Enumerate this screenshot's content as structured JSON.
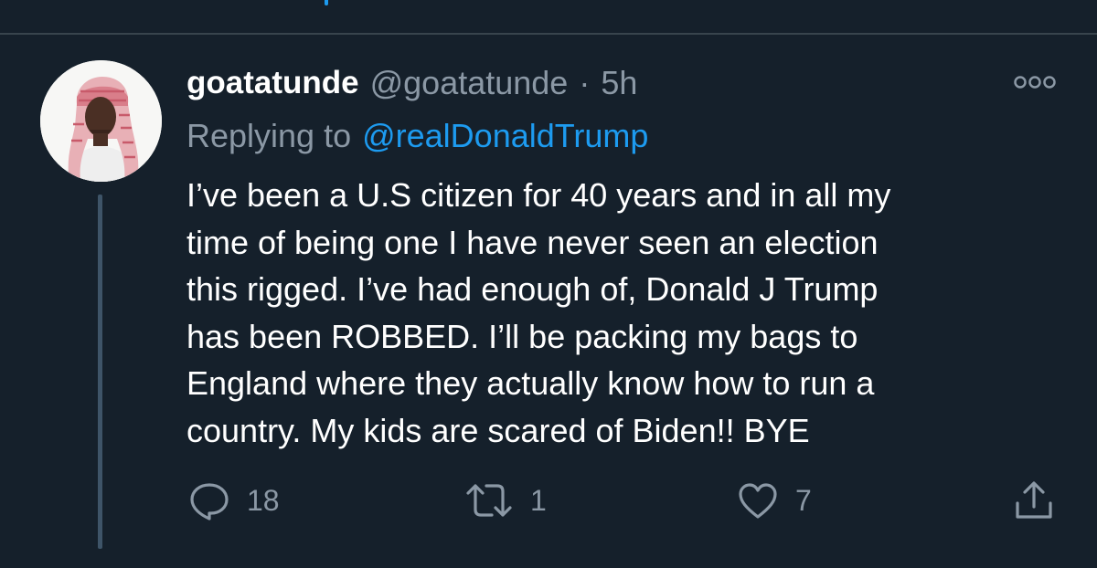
{
  "tweet": {
    "display_name": "goatatunde",
    "handle": "@goatatunde",
    "separator": "·",
    "time_ago": "5h",
    "replying_label": "Replying to",
    "replying_to": "@realDonaldTrump",
    "text_lines": [
      "I’ve been a U.S citizen for 40 years and in all my",
      "time of being one I have never seen an election",
      "this rigged. I’ve had enough of, Donald J Trump",
      "has been ROBBED. I’ll be packing my bags to",
      "England where they actually know how to run a",
      "country. My kids are scared of Biden!! BYE"
    ]
  },
  "actions": {
    "reply": {
      "icon": "reply-icon",
      "count": "18"
    },
    "retweet": {
      "icon": "retweet-icon",
      "count": "1"
    },
    "like": {
      "icon": "heart-icon",
      "count": "7"
    },
    "share": {
      "icon": "share-icon"
    }
  },
  "colors": {
    "background": "#15202b",
    "text_primary": "#ffffff",
    "text_secondary": "#8b98a5",
    "link": "#1d9bf0",
    "divider": "#38444d",
    "thread_line": "#3e5468"
  }
}
